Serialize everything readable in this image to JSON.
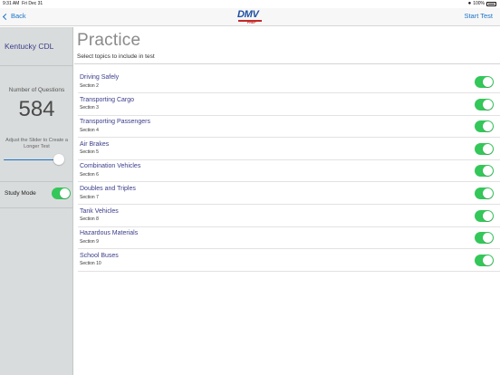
{
  "status": {
    "time": "9:31 AM",
    "date": "Fri Dec 31",
    "battery": "100%"
  },
  "nav": {
    "back_label": "Back",
    "logo_text": "DMV",
    "logo_sub": "PREP",
    "start_label": "Start Test"
  },
  "sidebar": {
    "title": "Kentucky CDL",
    "questions_label": "Number of Questions",
    "question_count": "584",
    "slider_hint": "Adjust the Slider to Create a Longer Test",
    "slider_fraction": 0.92,
    "study_mode_label": "Study Mode",
    "study_mode_on": true
  },
  "main": {
    "title": "Practice",
    "subtitle": "Select topics to include in test",
    "topics": [
      {
        "name": "Driving Safely",
        "section": "Section 2",
        "enabled": true
      },
      {
        "name": "Transporting Cargo",
        "section": "Section 3",
        "enabled": true
      },
      {
        "name": "Transporting Passengers",
        "section": "Section 4",
        "enabled": true
      },
      {
        "name": "Air Brakes",
        "section": "Section 5",
        "enabled": true
      },
      {
        "name": "Combination Vehicles",
        "section": "Section 6",
        "enabled": true
      },
      {
        "name": "Doubles and Triples",
        "section": "Section 7",
        "enabled": true
      },
      {
        "name": "Tank Vehicles",
        "section": "Section 8",
        "enabled": true
      },
      {
        "name": "Hazardous Materials",
        "section": "Section 9",
        "enabled": true
      },
      {
        "name": "School Buses",
        "section": "Section 10",
        "enabled": true
      }
    ]
  },
  "colors": {
    "accent": "#1a73c9",
    "toggle_on": "#34c759",
    "sidebar_bg": "#d9dcdc",
    "topic_text": "#3b3d8a"
  }
}
